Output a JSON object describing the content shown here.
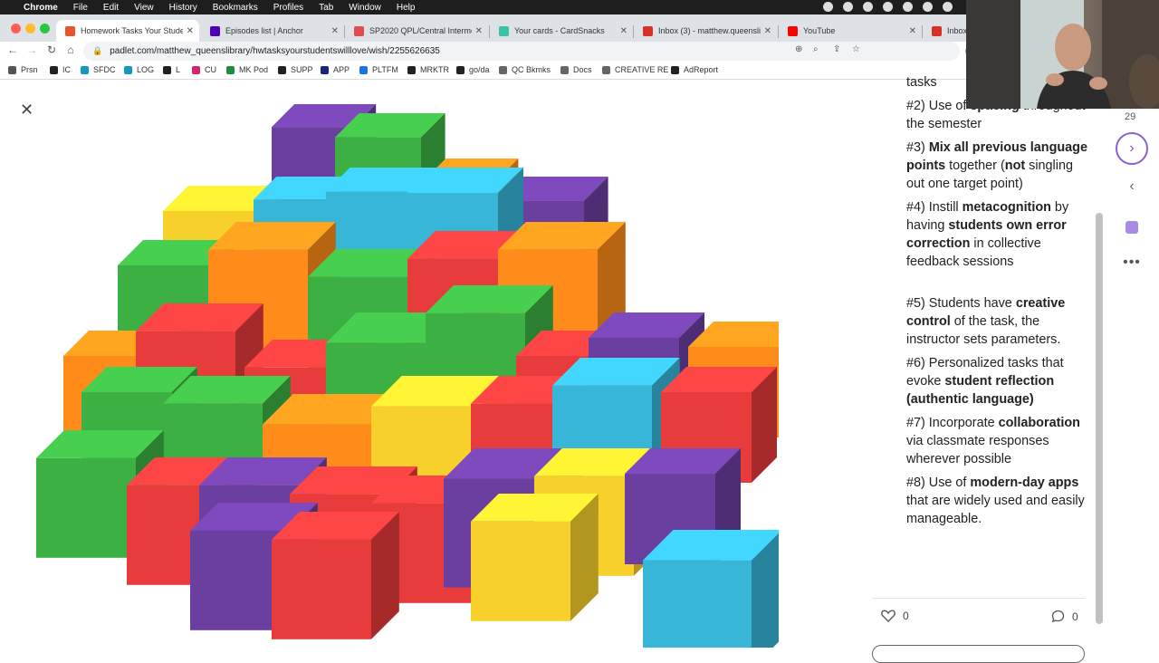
{
  "menubar": {
    "app": "Chrome",
    "items": [
      "File",
      "Edit",
      "View",
      "History",
      "Bookmarks",
      "Profiles",
      "Tab",
      "Window",
      "Help"
    ]
  },
  "tabs": [
    {
      "title": "Homework Tasks Your Student",
      "color": "#e8552d",
      "active": true
    },
    {
      "title": "Episodes list | Anchor",
      "color": "#5000b9",
      "active": false
    },
    {
      "title": "SP2020 QPL/Central Intermedi",
      "color": "#e24c4c",
      "active": false
    },
    {
      "title": "Your cards - CardSnacks",
      "color": "#37c3a8",
      "active": false
    },
    {
      "title": "Inbox (3) - matthew.queenslibr",
      "color": "#d93025",
      "active": false
    },
    {
      "title": "YouTube",
      "color": "#ff0000",
      "active": false
    },
    {
      "title": "Inbox (",
      "color": "#d93025",
      "active": false
    }
  ],
  "toolbar": {
    "url": "padlet.com/matthew_queenslibrary/hwtasksyourstudentswilllove/wish/2255626635"
  },
  "bookmarks": [
    {
      "label": "Prsn",
      "color": "#555555"
    },
    {
      "label": "IC",
      "color": "#222222"
    },
    {
      "label": "SFDC",
      "color": "#1798c1"
    },
    {
      "label": "LOG",
      "color": "#1798c1"
    },
    {
      "label": "L",
      "color": "#222222"
    },
    {
      "label": "CU",
      "color": "#d6246e"
    },
    {
      "label": "MK Pod",
      "color": "#1e8e3e"
    },
    {
      "label": "SUPP",
      "color": "#222222"
    },
    {
      "label": "APP",
      "color": "#1a237e"
    },
    {
      "label": "PLTFM",
      "color": "#1a73e8"
    },
    {
      "label": "MRKTR",
      "color": "#222222"
    },
    {
      "label": "go/da",
      "color": "#222222"
    },
    {
      "label": "QC Bkmks",
      "color": "#666666"
    },
    {
      "label": "Docs",
      "color": "#666666"
    },
    {
      "label": "CREATIVE RE",
      "color": "#666666"
    },
    {
      "label": "AdReport",
      "color": "#222222"
    }
  ],
  "post": {
    "cutoff": "tasks",
    "items": [
      {
        "parts": [
          [
            "#2) Use of ",
            false
          ],
          [
            "spacing",
            true
          ],
          [
            " throughout the semester",
            false
          ]
        ]
      },
      {
        "parts": [
          [
            "#3) ",
            false
          ],
          [
            "Mix all previous language points",
            true
          ],
          [
            " together (",
            false
          ],
          [
            "not",
            true
          ],
          [
            " singling out one target point)",
            false
          ]
        ]
      },
      {
        "parts": [
          [
            "#4) Instill ",
            false
          ],
          [
            "metacognition",
            true
          ],
          [
            " by having ",
            false
          ],
          [
            "students own error correction",
            true
          ],
          [
            " in collective feedback sessions",
            false
          ]
        ]
      },
      {
        "gap": true
      },
      {
        "parts": [
          [
            "#5) Students have ",
            false
          ],
          [
            "creative control",
            true
          ],
          [
            " of the task, the instructor sets parameters.",
            false
          ]
        ]
      },
      {
        "parts": [
          [
            "#6) Personalized tasks that evoke ",
            false
          ],
          [
            "student reflection (authentic language)",
            true
          ]
        ]
      },
      {
        "parts": [
          [
            "#7) Incorporate ",
            false
          ],
          [
            "collaboration",
            true
          ],
          [
            " via classmate responses wherever possible",
            false
          ]
        ]
      },
      {
        "parts": [
          [
            "#8) Use of ",
            false
          ],
          [
            "modern-day apps",
            true
          ],
          [
            " that are widely used and easily manageable.",
            false
          ]
        ]
      }
    ],
    "likes": "0",
    "comments": "0"
  },
  "rail": {
    "count": "29"
  },
  "colors": {
    "accent": "#8b5fd1",
    "blocks": [
      "#e83b3b",
      "#3cb043",
      "#f7d02c",
      "#ff8c1a",
      "#38b6d8",
      "#6b3fa0"
    ]
  }
}
